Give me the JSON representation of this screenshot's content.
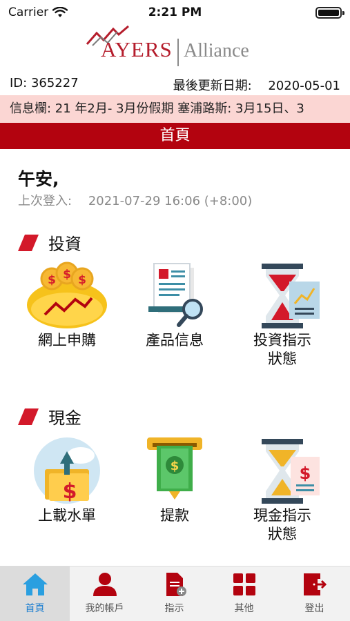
{
  "status_bar": {
    "carrier": "Carrier",
    "time": "2:21 PM"
  },
  "logo": {
    "brand_left": "AYERS",
    "brand_right": "Alliance"
  },
  "info": {
    "id_text": "ID: 365227",
    "update_label": "最後更新日期:",
    "update_date": "2020-05-01"
  },
  "marquee": {
    "text": "信息欄: 21 年2月- 3月份假期 塞浦路斯: 3月15日、3"
  },
  "page_title": "首頁",
  "greeting": {
    "text": "午安,",
    "last_login_label": "上次登入:",
    "last_login_value": "2021-07-29 16:06 (+8:00)"
  },
  "sections": {
    "investment": {
      "title": "投資",
      "tiles": [
        "網上申購",
        "產品信息",
        "投資指示\n狀態"
      ]
    },
    "cash": {
      "title": "現金",
      "tiles": [
        "上載水單",
        "提款",
        "現金指示\n狀態"
      ]
    }
  },
  "tabbar": {
    "items": [
      "首頁",
      "我的帳戶",
      "指示",
      "其他",
      "登出"
    ],
    "active_index": 0
  },
  "colors": {
    "brand_red": "#b3030f",
    "marquee_bg": "#fbd6d3",
    "tab_active": "#1e7fd0"
  }
}
